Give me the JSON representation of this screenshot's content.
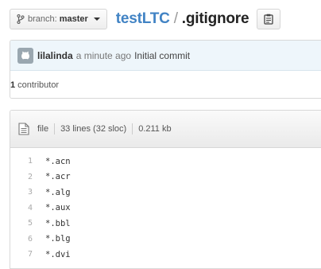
{
  "header": {
    "branch_prefix": "branch:",
    "branch_name": "master",
    "repo_name": "testLTC",
    "path_separator": "/",
    "file_name": ".gitignore"
  },
  "commit": {
    "author": "lilalinda",
    "time": "a minute ago",
    "message": "Initial commit",
    "contributor_count": "1",
    "contributor_label": "contributor"
  },
  "file": {
    "mode": "file",
    "lines_info": "33 lines (32 sloc)",
    "size": "0.211 kb"
  },
  "code_lines": [
    {
      "num": "1",
      "text": "*.acn"
    },
    {
      "num": "2",
      "text": "*.acr"
    },
    {
      "num": "3",
      "text": "*.alg"
    },
    {
      "num": "4",
      "text": "*.aux"
    },
    {
      "num": "5",
      "text": "*.bbl"
    },
    {
      "num": "6",
      "text": "*.blg"
    },
    {
      "num": "7",
      "text": "*.dvi"
    }
  ],
  "icons": {
    "branch": "branch-icon",
    "caret": "chevron-down-icon",
    "clipboard": "clipboard-icon",
    "avatar": "octocat-avatar-icon",
    "file": "file-text-icon"
  },
  "colors": {
    "link": "#4183c4",
    "commit_bg": "#eef6fb"
  }
}
